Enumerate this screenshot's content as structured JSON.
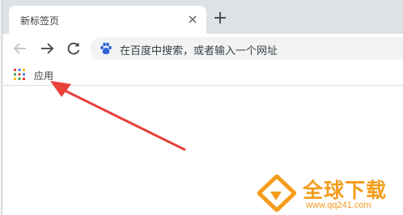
{
  "tab": {
    "title": "新标签页"
  },
  "omnibox": {
    "placeholder": "在百度中搜索，或者输入一个网址"
  },
  "bookmarks": {
    "items": [
      {
        "label": "应用",
        "icon": "apps-grid-icon"
      }
    ]
  },
  "icons": {
    "close": "close-icon",
    "new_tab": "plus-icon",
    "back": "back-arrow-icon",
    "forward": "forward-arrow-icon",
    "reload": "reload-icon",
    "search_engine": "baidu-paw-icon"
  },
  "annotation": {
    "color": "#e8413a"
  },
  "watermark": {
    "title": "全球下载",
    "url": "www.qq241.com",
    "color": "#f49c1b"
  },
  "colors": {
    "tabstrip": "#dee1e6",
    "omnibox": "#f1f3f4",
    "baidu_blue": "#2f63d8"
  }
}
